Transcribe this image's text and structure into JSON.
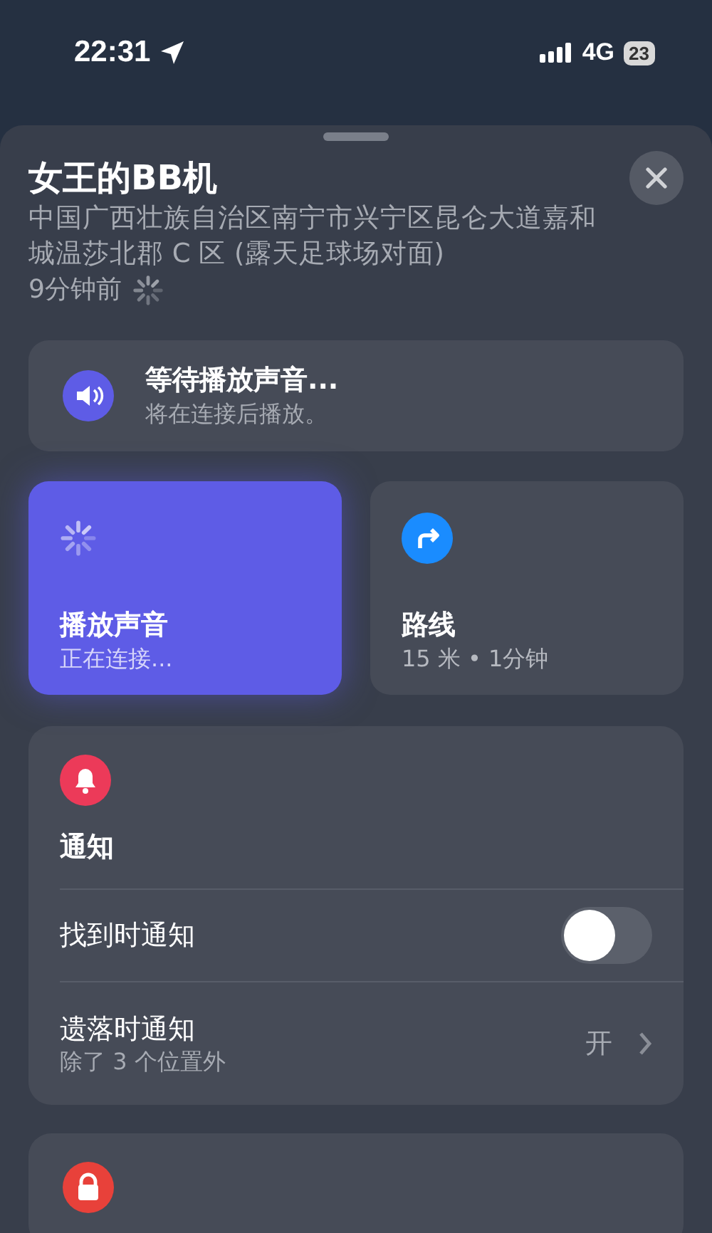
{
  "status_bar": {
    "time": "22:31",
    "network": "4G",
    "battery": "23"
  },
  "sheet": {
    "title": "女王的BB机",
    "address": "中国广西壮族自治区南宁市兴宁区昆仑大道嘉和城温莎北郡 C 区 (露天足球场对面)",
    "updated": "9分钟前"
  },
  "banner": {
    "title": "等待播放声音...",
    "subtitle": "将在连接后播放。"
  },
  "actions": [
    {
      "kind": "sound",
      "label": "播放声音",
      "detail": "正在连接...",
      "active": true
    },
    {
      "kind": "route",
      "label": "路线",
      "detail": "15 米 • 1分钟",
      "active": false
    }
  ],
  "notifications": {
    "title": "通知",
    "rows": [
      {
        "kind": "toggle",
        "label": "找到时通知",
        "on": false
      },
      {
        "kind": "disclosure",
        "label": "遗落时通知",
        "detail": "除了 3 个位置外",
        "value": "开"
      }
    ]
  }
}
